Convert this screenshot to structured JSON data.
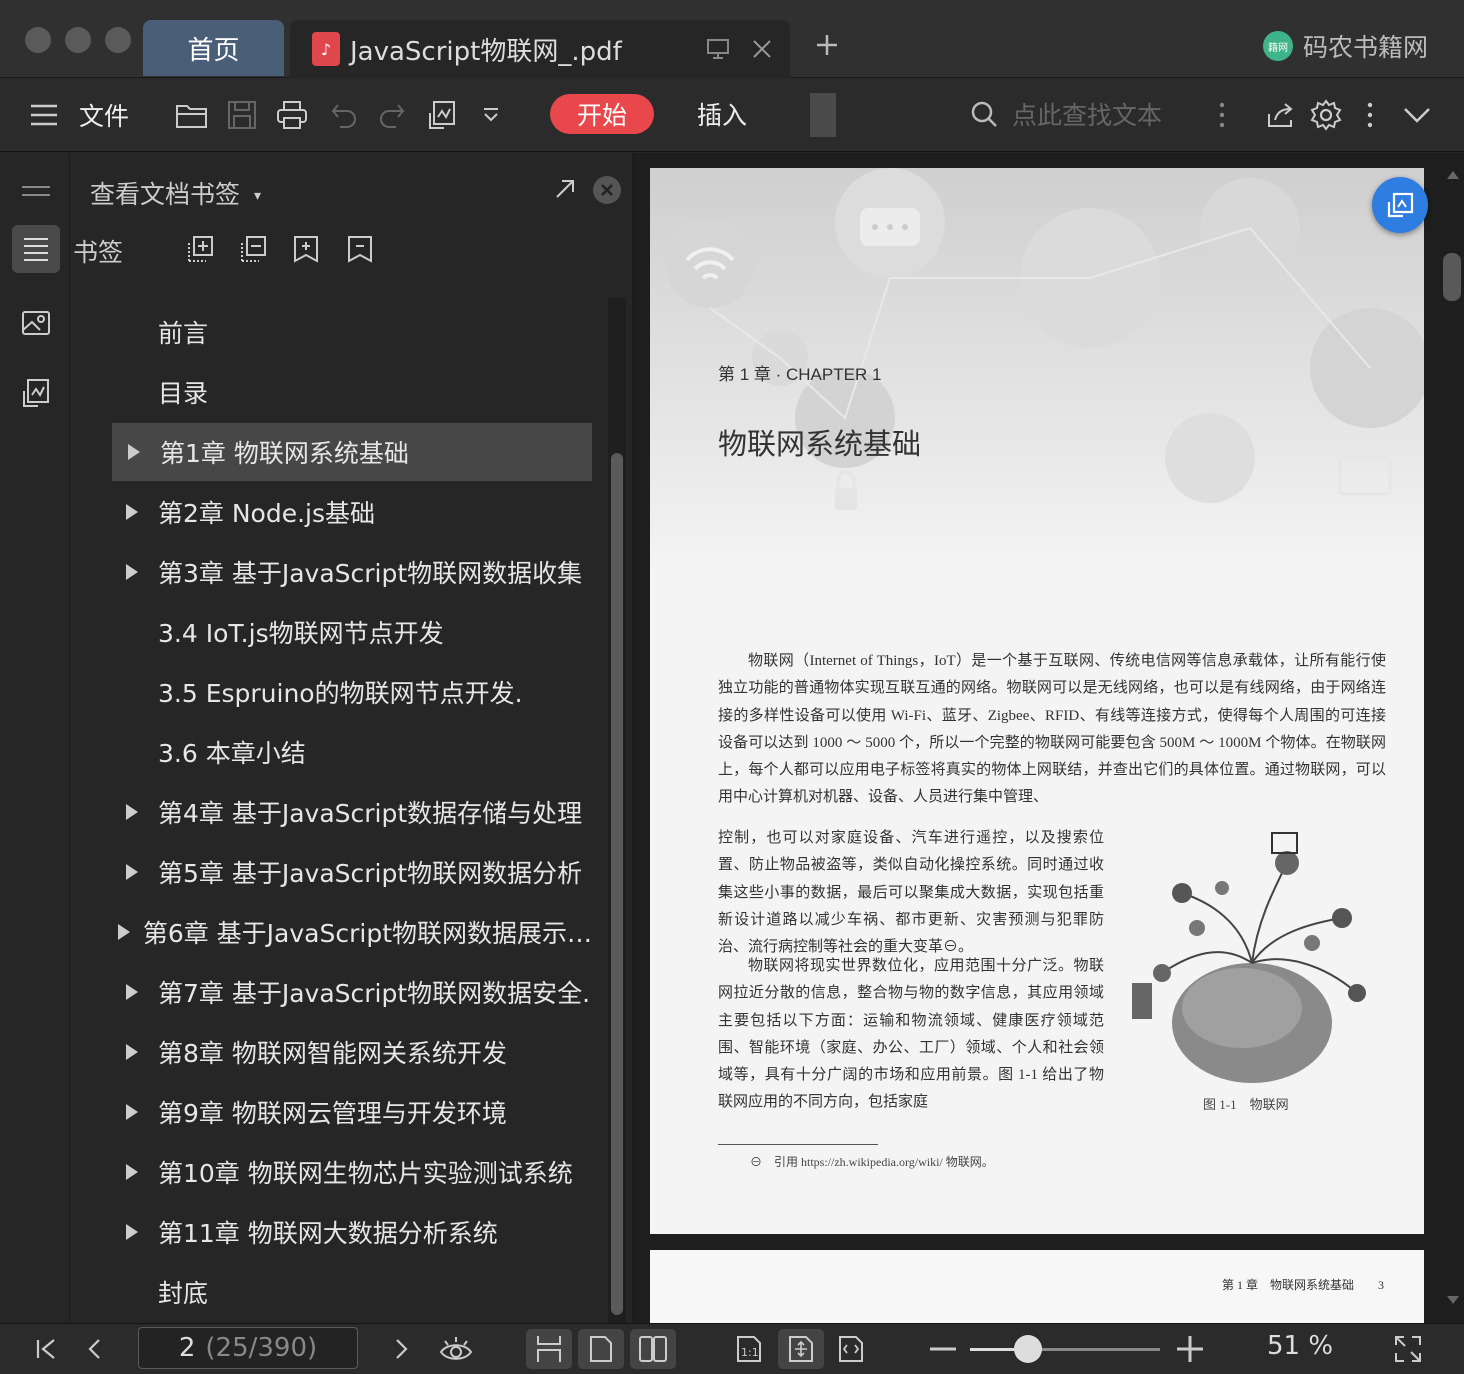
{
  "tabbar": {
    "home_tab": "首页",
    "doc_tab": "JavaScript物联网_.pdf",
    "brand": "码农书籍网",
    "brand_logo_text": "籍网"
  },
  "toolbar": {
    "file_label": "文件",
    "start_tab": "开始",
    "insert_tab": "插入",
    "search_placeholder": "点此查找文本",
    "accent_color": "#e8484c"
  },
  "panel": {
    "title": "查看文档书签",
    "bookmarks_label": "书签",
    "items": [
      {
        "label": "前言",
        "expandable": false,
        "selected": false
      },
      {
        "label": "目录",
        "expandable": false,
        "selected": false
      },
      {
        "label": "第1章 物联网系统基础",
        "expandable": true,
        "selected": true
      },
      {
        "label": "第2章 Node.js基础",
        "expandable": true,
        "selected": false
      },
      {
        "label": "第3章 基于JavaScript物联网数据收集",
        "expandable": true,
        "selected": false
      },
      {
        "label": "3.4 IoT.js物联网节点开发",
        "expandable": false,
        "selected": false
      },
      {
        "label": "3.5 Espruino的物联网节点开发.",
        "expandable": false,
        "selected": false
      },
      {
        "label": "3.6 本章小结",
        "expandable": false,
        "selected": false
      },
      {
        "label": "第4章 基于JavaScript数据存储与处理",
        "expandable": true,
        "selected": false
      },
      {
        "label": "第5章 基于JavaScript物联网数据分析",
        "expandable": true,
        "selected": false
      },
      {
        "label": "第6章 基于JavaScript物联网数据展示…",
        "expandable": true,
        "selected": false
      },
      {
        "label": "第7章 基于JavaScript物联网数据安全.",
        "expandable": true,
        "selected": false
      },
      {
        "label": "第8章 物联网智能网关系统开发",
        "expandable": true,
        "selected": false
      },
      {
        "label": "第9章 物联网云管理与开发环境",
        "expandable": true,
        "selected": false
      },
      {
        "label": "第10章 物联网生物芯片实验测试系统",
        "expandable": true,
        "selected": false
      },
      {
        "label": "第11章 物联网大数据分析系统",
        "expandable": true,
        "selected": false
      },
      {
        "label": "封底",
        "expandable": false,
        "selected": false
      }
    ]
  },
  "document": {
    "chapter_label": "第 1 章 · CHAPTER 1",
    "chapter_title": "物联网系统基础",
    "para1": "物联网（Internet of Things，IoT）是一个基于互联网、传统电信网等信息承载体，让所有能行使独立功能的普通物体实现互联互通的网络。物联网可以是无线网络，也可以是有线网络，由于网络连接的多样性设备可以使用 Wi-Fi、蓝牙、Zigbee、RFID、有线等连接方式，使得每个人周围的可连接设备可以达到 1000 ～ 5000 个，所以一个完整的物联网可能要包含 500M ～ 1000M 个物体。在物联网上，每个人都可以应用电子标签将真实的物体上网联结，并查出它们的具体位置。通过物联网，可以用中心计算机对机器、设备、人员进行集中管理、",
    "para1_cont": "控制，也可以对家庭设备、汽车进行遥控，以及搜索位置、防止物品被盗等，类似自动化操控系统。同时通过收集这些小事的数据，最后可以聚集成大数据，实现包括重新设计道路以减少车祸、都市更新、灾害预测与犯罪防治、流行病控制等社会的重大变革⊖。",
    "para2": "物联网将现实世界数位化，应用范围十分广泛。物联网拉近分散的信息，整合物与物的数字信息，其应用领域主要包括以下方面：运输和物流领域、健康医疗领域范围、智能环境（家庭、办公、工厂）领域、个人和社会领域等，具有十分广阔的市场和应用前景。图 1-1 给出了物联网应用的不同方向，包括家庭",
    "figure_caption": "图 1-1　物联网",
    "footnote": "⊖　引用 https://zh.wikipedia.org/wiki/ 物联网。",
    "page2_header": "第 1 章　物联网系统基础　　3"
  },
  "status": {
    "page_current": "2",
    "page_total": "(25/390)",
    "zoom": "51 %"
  }
}
